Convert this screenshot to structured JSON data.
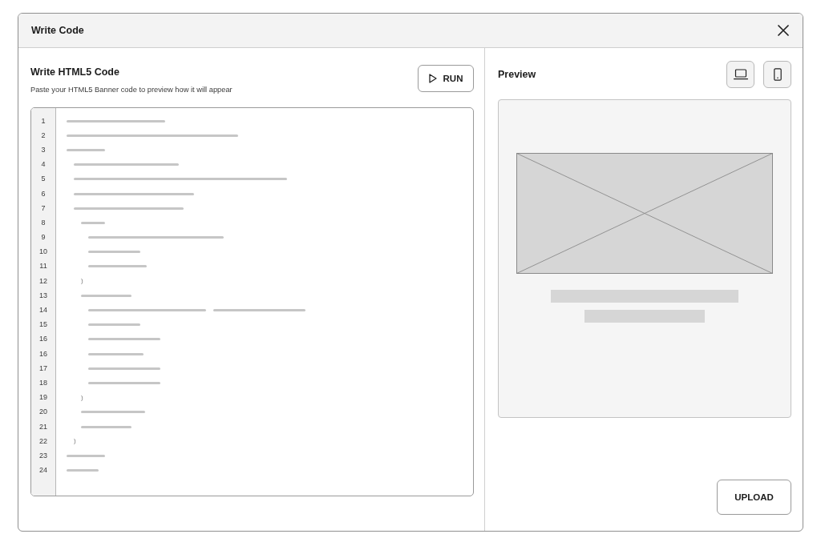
{
  "dialog": {
    "title": "Write Code"
  },
  "editor_panel": {
    "title": "Write HTML5 Code",
    "subtitle": "Paste your HTML5 Banner code to preview how it will appear",
    "run_button": {
      "label": "RUN"
    },
    "code_lines": [
      {
        "number": "1",
        "kind": "placeholder"
      },
      {
        "number": "2",
        "kind": "placeholder"
      },
      {
        "number": "3",
        "kind": "placeholder",
        "children": [
          {
            "number": "4",
            "kind": "placeholder"
          },
          {
            "number": "5",
            "kind": "placeholder"
          },
          {
            "number": "6",
            "kind": "placeholder"
          },
          {
            "number": "7",
            "kind": "placeholder",
            "children": [
              {
                "number": "8",
                "kind": "placeholder",
                "children": [
                  {
                    "number": "9",
                    "kind": "placeholder"
                  },
                  {
                    "number": "10",
                    "kind": "placeholder"
                  },
                  {
                    "number": "11",
                    "kind": "placeholder"
                  }
                ]
              },
              {
                "number": "12",
                "kind": "text",
                "text": ")"
              },
              {
                "number": "13",
                "kind": "placeholder",
                "children": [
                  {
                    "number": "14",
                    "kind": "placeholder"
                  },
                  {
                    "number": "15",
                    "kind": "placeholder"
                  },
                  {
                    "number": "16",
                    "kind": "placeholder"
                  },
                  {
                    "number": "16",
                    "kind": "placeholder"
                  },
                  {
                    "number": "17",
                    "kind": "placeholder"
                  },
                  {
                    "number": "18",
                    "kind": "placeholder"
                  }
                ]
              },
              {
                "number": "19",
                "kind": "text",
                "text": ")"
              },
              {
                "number": "20",
                "kind": "placeholder"
              },
              {
                "number": "21",
                "kind": "placeholder"
              }
            ]
          },
          {
            "number": "22",
            "kind": "text",
            "text": ")"
          }
        ]
      },
      {
        "number": "23",
        "kind": "placeholder"
      },
      {
        "number": "24",
        "kind": "placeholder"
      }
    ]
  },
  "preview_panel": {
    "title": "Preview",
    "devices": [
      {
        "kind": "laptop",
        "selected": false
      },
      {
        "kind": "phone",
        "selected": false
      }
    ],
    "upload_button": {
      "label": "UPLOAD"
    }
  }
}
